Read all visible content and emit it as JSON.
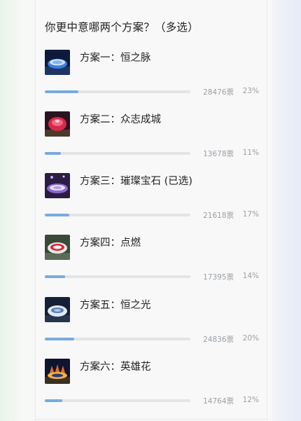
{
  "poll": {
    "question": "你更中意哪两个方案？（多选）",
    "vote_unit": "票",
    "options": [
      {
        "label": "方案一：恒之脉",
        "votes": "28476",
        "percent": "23%",
        "fraction": 0.23,
        "thumb_icon": "stadium-blue-night-icon"
      },
      {
        "label": "方案二：众志成城",
        "votes": "13678",
        "percent": "11%",
        "fraction": 0.11,
        "thumb_icon": "stadium-red-dome-icon"
      },
      {
        "label": "方案三：璀璨宝石 (已选)",
        "votes": "21618",
        "percent": "17%",
        "fraction": 0.17,
        "thumb_icon": "stadium-purple-gem-icon"
      },
      {
        "label": "方案四：点燃",
        "votes": "17395",
        "percent": "14%",
        "fraction": 0.14,
        "thumb_icon": "stadium-red-ring-icon"
      },
      {
        "label": "方案五：恒之光",
        "votes": "24836",
        "percent": "20%",
        "fraction": 0.2,
        "thumb_icon": "stadium-white-light-icon"
      },
      {
        "label": "方案六：英雄花",
        "votes": "14764",
        "percent": "12%",
        "fraction": 0.12,
        "thumb_icon": "stadium-flower-icon"
      }
    ]
  }
}
